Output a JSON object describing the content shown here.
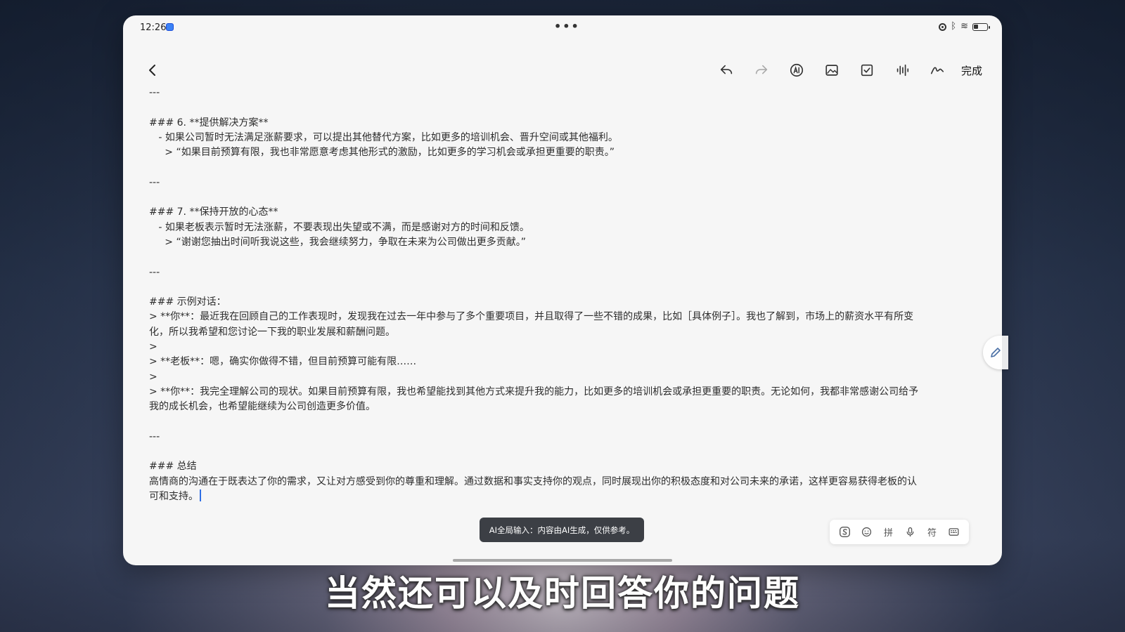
{
  "status_bar": {
    "time": "12:26",
    "more_indicator": "•••",
    "bluetooth_glyph": "ᛒ",
    "wifi_glyph": "≋"
  },
  "toolbar": {
    "back_icon": "chevron-left-icon",
    "tools": [
      {
        "name": "undo-icon"
      },
      {
        "name": "redo-icon"
      },
      {
        "name": "ai-icon"
      },
      {
        "name": "image-icon"
      },
      {
        "name": "checklist-icon"
      },
      {
        "name": "voice-icon"
      },
      {
        "name": "handwriting-icon"
      }
    ],
    "done_label": "完成"
  },
  "document": {
    "lines": [
      "---",
      "",
      "### 6. **提供解决方案**",
      "   - 如果公司暂时无法满足涨薪要求，可以提出其他替代方案，比如更多的培训机会、晋升空间或其他福利。",
      "     > “如果目前预算有限，我也非常愿意考虑其他形式的激励，比如更多的学习机会或承担更重要的职责。”",
      "",
      "---",
      "",
      "### 7. **保持开放的心态**",
      "   - 如果老板表示暂时无法涨薪，不要表现出失望或不满，而是感谢对方的时间和反馈。",
      "     > “谢谢您抽出时间听我说这些，我会继续努力，争取在未来为公司做出更多贡献。”",
      "",
      "---",
      "",
      "### 示例对话：",
      "> **你**：最近我在回顾自己的工作表现时，发现我在过去一年中参与了多个重要项目，并且取得了一些不错的成果，比如［具体例子］。我也了解到，市场上的薪资水平有所变",
      "化，所以我希望和您讨论一下我的职业发展和薪酬问题。",
      ">",
      "> **老板**：嗯，确实你做得不错，但目前预算可能有限……",
      ">",
      "> **你**：我完全理解公司的现状。如果目前预算有限，我也希望能找到其他方式来提升我的能力，比如更多的培训机会或承担更重要的职责。无论如何，我都非常感谢公司给予",
      "我的成长机会，也希望能继续为公司创造更多价值。",
      "",
      "---",
      "",
      "### 总结",
      "高情商的沟通在于既表达了你的需求，又让对方感受到你的尊重和理解。通过数据和事实支持你的观点，同时展现出你的积极态度和对公司未来的承诺，这样更容易获得老板的认",
      "可和支持。"
    ]
  },
  "toast": {
    "text": "AI全局输入：内容由AI生成，仅供参考。"
  },
  "ime_bar": {
    "keys": [
      {
        "name": "sogou-logo-icon"
      },
      {
        "name": "emoji-icon"
      },
      {
        "name": "pinyin-key",
        "label": "拼"
      },
      {
        "name": "microphone-icon"
      },
      {
        "name": "symbol-key",
        "label": "符"
      },
      {
        "name": "keyboard-icon"
      }
    ]
  },
  "caption": {
    "text": "当然还可以及时回答你的问题"
  }
}
